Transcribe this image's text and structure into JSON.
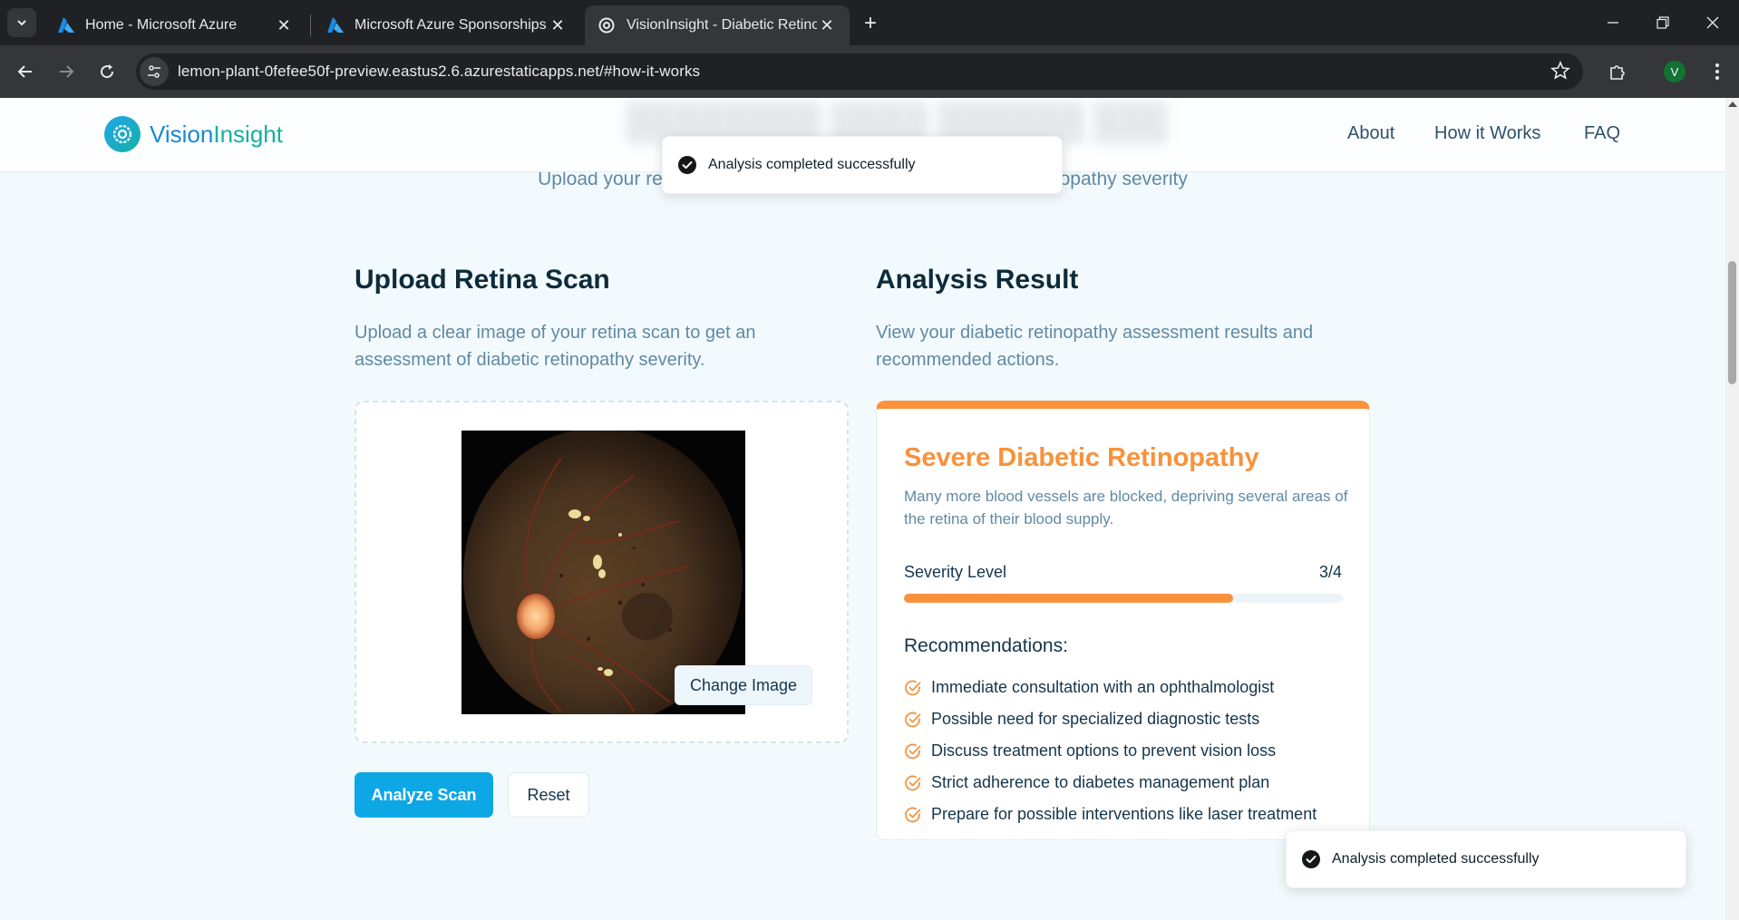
{
  "browser": {
    "tabs": [
      {
        "title": "Home - Microsoft Azure",
        "icon": "azure-logo-icon"
      },
      {
        "title": "Microsoft Azure Sponsorships |",
        "icon": "azure-logo-icon"
      },
      {
        "title": "VisionInsight - Diabetic Retinop",
        "icon": "gear-logo-icon",
        "active": true
      }
    ],
    "url": "lemon-plant-0fefee50f-preview.eastus2.6.azurestaticapps.net/#how-it-works",
    "profile_initial": "V"
  },
  "header": {
    "logo_part1": "Vision",
    "logo_part2": "Insight",
    "nav": [
      "About",
      "How it Works",
      "FAQ"
    ]
  },
  "hero": {
    "subtitle": "Upload your retina scan to get an assessment of diabetic retinopathy severity"
  },
  "upload": {
    "title": "Upload Retina Scan",
    "description": "Upload a clear image of your retina scan to get an assessment of diabetic retinopathy severity.",
    "change_image": "Change Image",
    "analyze": "Analyze Scan",
    "reset": "Reset"
  },
  "result": {
    "title": "Analysis Result",
    "description": "View your diabetic retinopathy assessment results and recommended actions.",
    "severity": "Severe Diabetic Retinopathy",
    "severity_description": "Many more blood vessels are blocked, depriving several areas of the retina of their blood supply.",
    "severity_label": "Severity Level",
    "severity_value": "3/4",
    "severity_fraction": 0.75,
    "accent_color": "#f7923c",
    "recommendations_title": "Recommendations:",
    "recommendations": [
      "Immediate consultation with an ophthalmologist",
      "Possible need for specialized diagnostic tests",
      "Discuss treatment options to prevent vision loss",
      "Strict adherence to diabetes management plan",
      "Prepare for possible interventions like laser treatment"
    ]
  },
  "toasts": {
    "message": "Analysis completed successfully"
  }
}
